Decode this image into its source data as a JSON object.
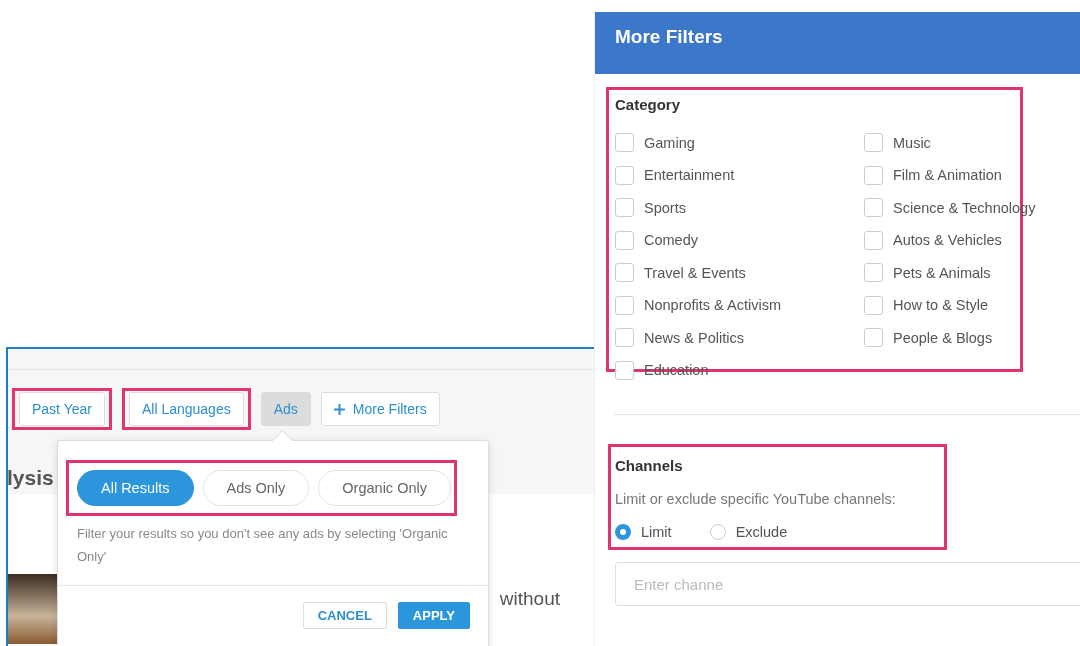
{
  "ads_panel": {
    "filters": [
      {
        "label": "Past Year",
        "kind": "dropdown",
        "selected": false,
        "highlighted": true
      },
      {
        "label": "All Languages",
        "kind": "dropdown",
        "selected": false,
        "highlighted": true
      },
      {
        "label": "Ads",
        "kind": "dropdown",
        "selected": true,
        "highlighted": false
      },
      {
        "label": "More Filters",
        "kind": "add",
        "selected": false,
        "highlighted": false
      }
    ],
    "heading": "lysis",
    "result_text": "without",
    "popover": {
      "options": [
        {
          "label": "All Results",
          "selected": true
        },
        {
          "label": "Ads Only",
          "selected": false
        },
        {
          "label": "Organic Only",
          "selected": false
        }
      ],
      "description": "Filter your results so you don't see any ads by selecting 'Organic Only'",
      "buttons": [
        {
          "label": "CANCEL",
          "kind": "secondary"
        },
        {
          "label": "APPLY",
          "kind": "primary"
        }
      ]
    }
  },
  "more_filters": {
    "title": "More Filters",
    "category": {
      "title": "Category",
      "items": [
        {
          "label": "Gaming",
          "checked": false
        },
        {
          "label": "Music",
          "checked": false
        },
        {
          "label": "Entertainment",
          "checked": false
        },
        {
          "label": "Film & Animation",
          "checked": false
        },
        {
          "label": "Sports",
          "checked": false
        },
        {
          "label": "Science & Technology",
          "checked": false
        },
        {
          "label": "Comedy",
          "checked": false
        },
        {
          "label": "Autos & Vehicles",
          "checked": false
        },
        {
          "label": "Travel & Events",
          "checked": false
        },
        {
          "label": "Pets & Animals",
          "checked": false
        },
        {
          "label": "Nonprofits & Activism",
          "checked": false
        },
        {
          "label": "How to & Style",
          "checked": false
        },
        {
          "label": "News & Politics",
          "checked": false
        },
        {
          "label": "People & Blogs",
          "checked": false
        },
        {
          "label": "Education",
          "checked": false
        }
      ]
    },
    "channels": {
      "title": "Channels",
      "description": "Limit or exclude specific YouTube channels:",
      "modes": [
        {
          "label": "Limit",
          "selected": true
        },
        {
          "label": "Exclude",
          "selected": false
        }
      ],
      "input": {
        "placeholder": "Enter channe"
      }
    }
  }
}
